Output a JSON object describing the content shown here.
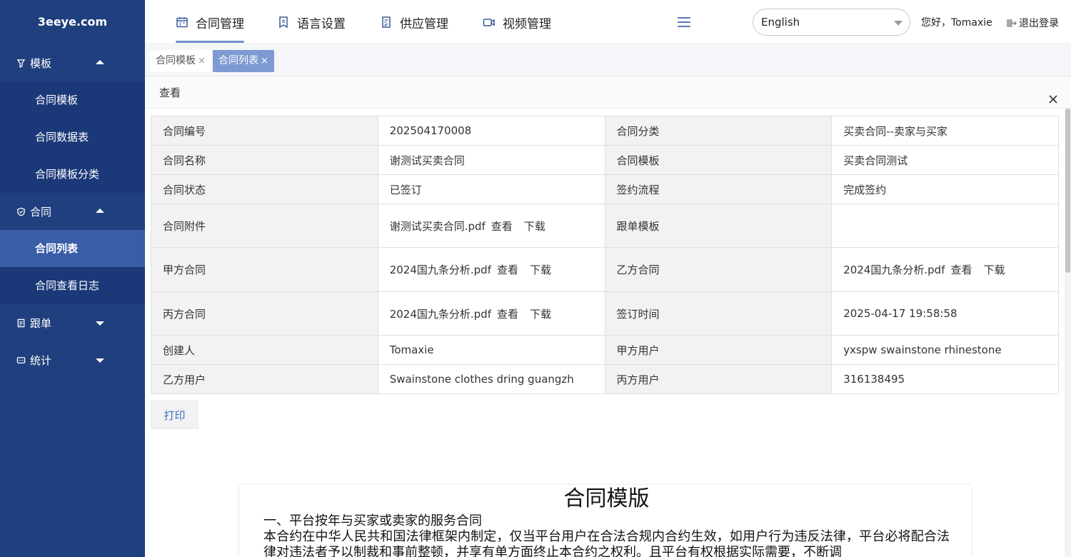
{
  "sidebar": {
    "logo": "3eeye.com",
    "groups": [
      {
        "label": "模板",
        "icon": "funnel-icon",
        "expanded": true,
        "items": [
          "合同模板",
          "合同数据表",
          "合同模板分类"
        ]
      },
      {
        "label": "合同",
        "icon": "shield-icon",
        "expanded": true,
        "items": [
          "合同列表",
          "合同查看日志"
        ]
      },
      {
        "label": "跟单",
        "icon": "document-icon",
        "expanded": false,
        "items": []
      },
      {
        "label": "统计",
        "icon": "chart-icon",
        "expanded": false,
        "items": []
      }
    ],
    "active_item": "合同列表"
  },
  "topbar": {
    "nav": [
      {
        "label": "合同管理",
        "icon": "calendar-icon",
        "active": true
      },
      {
        "label": "语言设置",
        "icon": "bookmark-icon",
        "active": false
      },
      {
        "label": "供应管理",
        "icon": "checklist-icon",
        "active": false
      },
      {
        "label": "视频管理",
        "icon": "video-icon",
        "active": false
      }
    ],
    "language": "English",
    "greeting": "您好，Tomaxie",
    "logout": "退出登录"
  },
  "tabs": [
    {
      "label": "合同模板",
      "close": "×",
      "active": false
    },
    {
      "label": "合同列表",
      "close": "×",
      "active": true
    }
  ],
  "panel": {
    "title": "查看",
    "rows": [
      {
        "l1": "合同编号",
        "v1": "202504170008",
        "l2": "合同分类",
        "v2": "买卖合同--卖家与买家"
      },
      {
        "l1": "合同名称",
        "v1": "谢测试买卖合同",
        "l2": "合同模板",
        "v2": "买卖合同测试"
      },
      {
        "l1": "合同状态",
        "v1": "已签订",
        "l2": "签约流程",
        "v2": "完成签约"
      },
      {
        "l1": "合同附件",
        "v1": "谢测试买卖合同.pdf",
        "l2": "跟单模板",
        "v2": ""
      },
      {
        "l1": "甲方合同",
        "v1": "2024国九条分析.pdf",
        "l2": "乙方合同",
        "v2": "2024国九条分析.pdf"
      },
      {
        "l1": "丙方合同",
        "v1": "2024国九条分析.pdf",
        "l2": "签订时间",
        "v2": "2025-04-17 19:58:58"
      },
      {
        "l1": "创建人",
        "v1": "Tomaxie",
        "l2": "甲方用户",
        "v2": "yxspw swainstone rhinestone"
      },
      {
        "l1": "乙方用户",
        "v1": "Swainstone clothes dring guangzh",
        "l2": "丙方用户",
        "v2": "316138495"
      }
    ],
    "view_link": "查看",
    "download_link": "下载",
    "print_button": "打印"
  },
  "document": {
    "title": "合同模版",
    "section": "一、平台按年与买家或卖家的服务合同",
    "paragraph": "本合约在中华人民共和国法律框架内制定，仅当平台用户在合法合规内合约生效，如用户行为违反法律，平台必将配合法律对违法者予以制裁和事前整顿，并享有单方面终止本合约之权利。且平台有权根据实际需要，不断调"
  }
}
